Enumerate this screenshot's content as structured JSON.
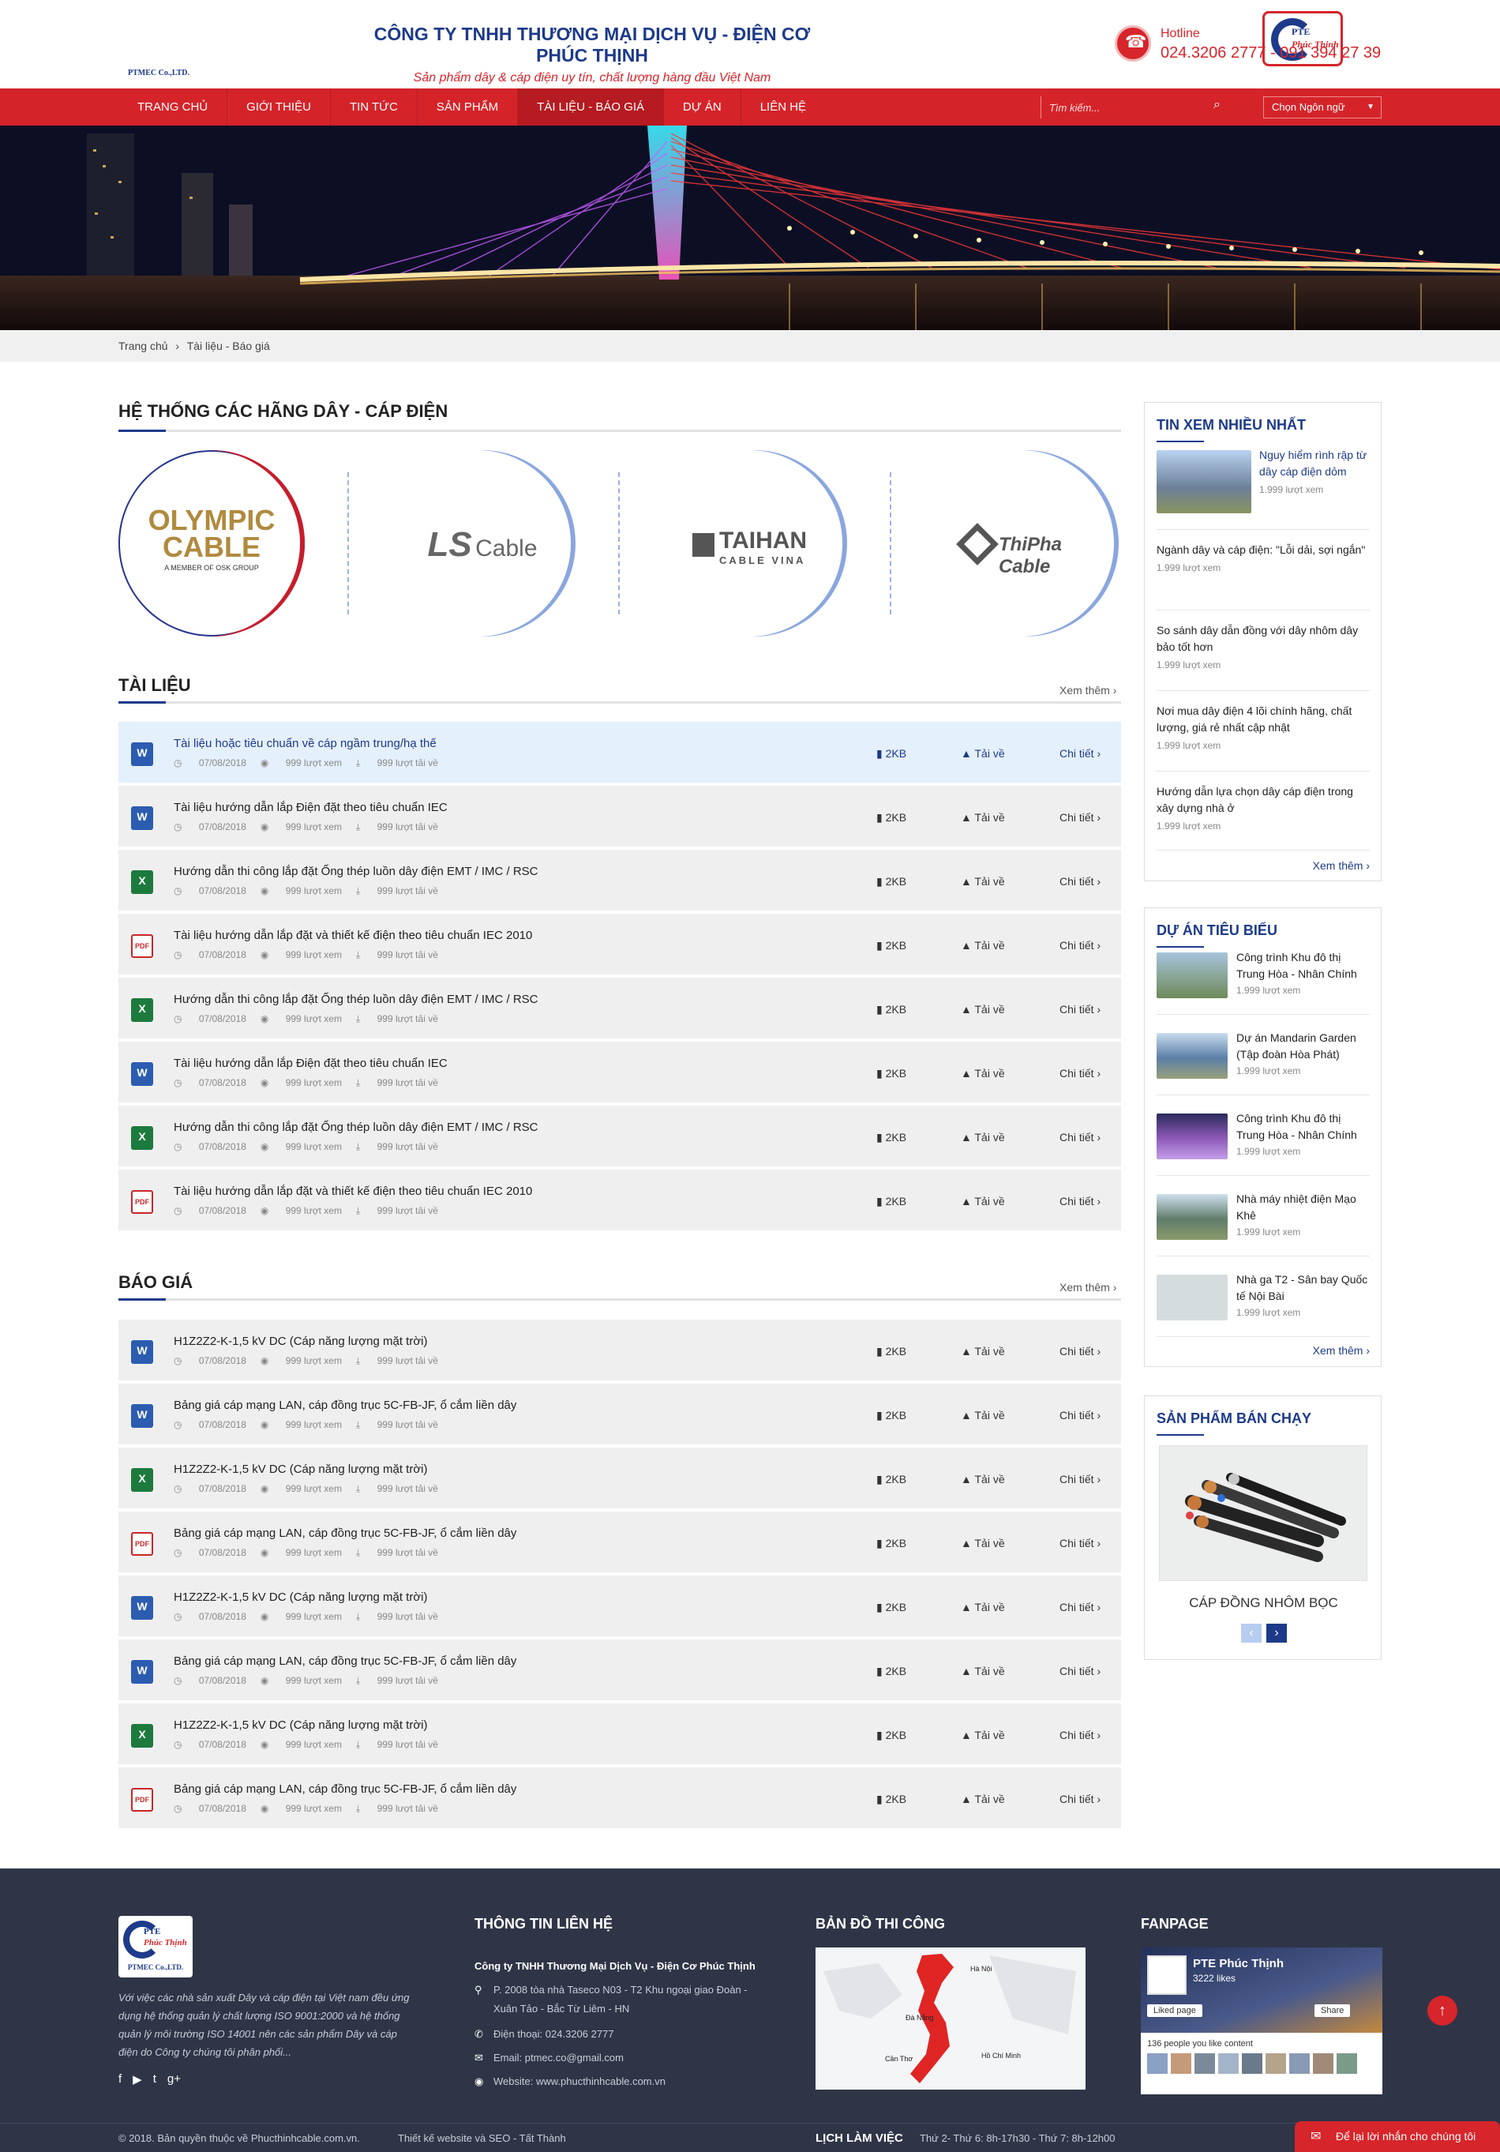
{
  "header": {
    "logo_pte": "PTE",
    "logo_name": "Phúc Thịnh",
    "logo_sub": "PTMEC Co.,LTD.",
    "company_name": "CÔNG TY TNHH THƯƠNG MẠI DỊCH VỤ - ĐIỆN CƠ PHÚC THỊNH",
    "slogan": "Sản phẩm dây & cáp điện uy tín, chất lượng hàng đầu Việt Nam",
    "hotline_label": "Hotline",
    "hotline_number": "024.3206 2777 - 091 394 27 39"
  },
  "nav": {
    "items": [
      "TRANG CHỦ",
      "GIỚI THIỆU",
      "TIN TỨC",
      "SẢN PHẨM",
      "TÀI LIỆU - BÁO GIÁ",
      "DỰ ÁN",
      "LIÊN HỆ"
    ],
    "active": "TÀI LIỆU - BÁO GIÁ",
    "search_placeholder": "Tìm kiếm...",
    "language": "Chọn Ngôn ngữ"
  },
  "breadcrumb": [
    "Trang chủ",
    "›",
    "Tài liệu - Báo giá"
  ],
  "brands": {
    "title": "HỆ THỐNG CÁC HÃNG DÂY - CÁP ĐIỆN",
    "items": [
      {
        "line1": "OLYMPIC",
        "line2": "CABLE",
        "sub": "A MEMBER OF OSK GROUP"
      },
      {
        "line1": "LS",
        "line2": "Cable"
      },
      {
        "line1": "TAIHAN",
        "line2": "CABLE VINA"
      },
      {
        "line1": "ThiPha Cable"
      }
    ]
  },
  "documents": {
    "title": "TÀI LIỆU",
    "more": "Xem thêm ›",
    "rows": [
      {
        "icon": "word",
        "title": "Tài liệu hoặc tiêu chuẩn về cáp ngầm trung/hạ thế",
        "date": "07/08/2018",
        "views": "999 lượt xem",
        "downloads": "999 lượt tải về",
        "size": "2KB",
        "dl": "Tải về",
        "detail": "Chi tiết ›"
      },
      {
        "icon": "word",
        "title": "Tài liệu hướng dẫn lắp Điện đặt theo tiêu chuẩn IEC",
        "date": "07/08/2018",
        "views": "999 lượt xem",
        "downloads": "999 lượt tải về",
        "size": "2KB",
        "dl": "Tải về",
        "detail": "Chi tiết ›"
      },
      {
        "icon": "excel",
        "title": "Hướng dẫn thi công lắp đặt Ống thép luồn dây điện EMT / IMC / RSC",
        "date": "07/08/2018",
        "views": "999 lượt xem",
        "downloads": "999 lượt tải về",
        "size": "2KB",
        "dl": "Tải về",
        "detail": "Chi tiết ›"
      },
      {
        "icon": "pdf",
        "title": "Tài liệu hướng dẫn lắp đặt và thiết kế điện theo tiêu chuẩn IEC 2010",
        "date": "07/08/2018",
        "views": "999 lượt xem",
        "downloads": "999 lượt tải về",
        "size": "2KB",
        "dl": "Tải về",
        "detail": "Chi tiết ›"
      },
      {
        "icon": "excel",
        "title": "Hướng dẫn thi công lắp đặt Ống thép luồn dây điện EMT / IMC / RSC",
        "date": "07/08/2018",
        "views": "999 lượt xem",
        "downloads": "999 lượt tải về",
        "size": "2KB",
        "dl": "Tải về",
        "detail": "Chi tiết ›"
      },
      {
        "icon": "word",
        "title": "Tài liệu hướng dẫn lắp Điện đặt theo tiêu chuẩn IEC",
        "date": "07/08/2018",
        "views": "999 lượt xem",
        "downloads": "999 lượt tải về",
        "size": "2KB",
        "dl": "Tải về",
        "detail": "Chi tiết ›"
      },
      {
        "icon": "excel",
        "title": "Hướng dẫn thi công lắp đặt Ống thép luồn dây điện EMT / IMC / RSC",
        "date": "07/08/2018",
        "views": "999 lượt xem",
        "downloads": "999 lượt tải về",
        "size": "2KB",
        "dl": "Tải về",
        "detail": "Chi tiết ›"
      },
      {
        "icon": "pdf",
        "title": "Tài liệu hướng dẫn lắp đặt và thiết kế điện theo tiêu chuẩn IEC 2010",
        "date": "07/08/2018",
        "views": "999 lượt xem",
        "downloads": "999 lượt tải về",
        "size": "2KB",
        "dl": "Tải về",
        "detail": "Chi tiết ›"
      }
    ]
  },
  "quotes": {
    "title": "BÁO GIÁ",
    "more": "Xem thêm ›",
    "rows": [
      {
        "icon": "word",
        "title": "H1Z2Z2-K-1,5 kV DC (Cáp năng lượng mặt trời)",
        "date": "07/08/2018",
        "views": "999 lượt xem",
        "downloads": "999 lượt tải về",
        "size": "2KB",
        "dl": "Tải về",
        "detail": "Chi tiết ›"
      },
      {
        "icon": "word",
        "title": "Bảng giá cáp mạng LAN, cáp đồng trục 5C-FB-JF, ổ cắm liền dây",
        "date": "07/08/2018",
        "views": "999 lượt xem",
        "downloads": "999 lượt tải về",
        "size": "2KB",
        "dl": "Tải về",
        "detail": "Chi tiết ›"
      },
      {
        "icon": "excel",
        "title": "H1Z2Z2-K-1,5 kV DC (Cáp năng lượng mặt trời)",
        "date": "07/08/2018",
        "views": "999 lượt xem",
        "downloads": "999 lượt tải về",
        "size": "2KB",
        "dl": "Tải về",
        "detail": "Chi tiết ›"
      },
      {
        "icon": "pdf",
        "title": "Bảng giá cáp mạng LAN, cáp đồng trục 5C-FB-JF, ổ cắm liền dây",
        "date": "07/08/2018",
        "views": "999 lượt xem",
        "downloads": "999 lượt tải về",
        "size": "2KB",
        "dl": "Tải về",
        "detail": "Chi tiết ›"
      },
      {
        "icon": "word",
        "title": "H1Z2Z2-K-1,5 kV DC (Cáp năng lượng mặt trời)",
        "date": "07/08/2018",
        "views": "999 lượt xem",
        "downloads": "999 lượt tải về",
        "size": "2KB",
        "dl": "Tải về",
        "detail": "Chi tiết ›"
      },
      {
        "icon": "word",
        "title": "Bảng giá cáp mạng LAN, cáp đồng trục 5C-FB-JF, ổ cắm liền dây",
        "date": "07/08/2018",
        "views": "999 lượt xem",
        "downloads": "999 lượt tải về",
        "size": "2KB",
        "dl": "Tải về",
        "detail": "Chi tiết ›"
      },
      {
        "icon": "excel",
        "title": "H1Z2Z2-K-1,5 kV DC (Cáp năng lượng mặt trời)",
        "date": "07/08/2018",
        "views": "999 lượt xem",
        "downloads": "999 lượt tải về",
        "size": "2KB",
        "dl": "Tải về",
        "detail": "Chi tiết ›"
      },
      {
        "icon": "pdf",
        "title": "Bảng giá cáp mạng LAN, cáp đồng trục 5C-FB-JF, ổ cắm liền dây",
        "date": "07/08/2018",
        "views": "999 lượt xem",
        "downloads": "999 lượt tải về",
        "size": "2KB",
        "dl": "Tải về",
        "detail": "Chi tiết ›"
      }
    ]
  },
  "sidebar": {
    "popular": {
      "title": "TIN XEM NHIỀU NHẤT",
      "featured": {
        "title": "Nguy hiểm rình rập từ dây cáp điện dỏm",
        "views": "1.999 lượt xem"
      },
      "items": [
        {
          "title": "Ngành dây và cáp điện: \"Lỗi dải, sợi ngắn\"",
          "views": "1.999 lượt xem"
        },
        {
          "title": "So sánh dây dẫn đồng với dây nhôm dây bảo tốt hơn",
          "views": "1.999 lượt xem"
        },
        {
          "title": "Nơi mua dây điện 4 lõi chính hãng, chất lượng, giá rẻ nhất cập nhật",
          "views": "1.999 lượt xem"
        },
        {
          "title": "Hướng dẫn lựa chọn dây cáp điện trong xây dựng nhà ở",
          "views": "1.999 lượt xem"
        }
      ],
      "more": "Xem thêm ›"
    },
    "projects": {
      "title": "DỰ ÁN TIÊU BIỂU",
      "items": [
        {
          "title": "Công trình Khu đô thị Trung Hòa - Nhân Chính",
          "views": "1.999 lượt xem"
        },
        {
          "title": "Dự án Mandarin Garden (Tập đoàn Hòa Phát)",
          "views": "1.999 lượt xem"
        },
        {
          "title": "Công trình Khu đô thị Trung Hòa - Nhân Chính",
          "views": "1.999 lượt xem"
        },
        {
          "title": "Nhà máy nhiệt điện Mạo Khê",
          "views": "1.999 lượt xem"
        },
        {
          "title": "Nhà ga T2 - Sân bay Quốc tế Nội Bài",
          "views": "1.999 lượt xem"
        }
      ],
      "more": "Xem thêm ›"
    },
    "bestseller": {
      "title": "SẢN PHẨM BÁN CHẠY",
      "product": "CÁP ĐỒNG NHÔM BỌC",
      "prev": "‹",
      "next": "›"
    }
  },
  "footer": {
    "about": "Với việc các nhà sản xuất Dây và cáp điện tại Việt nam đều ứng dụng hệ thống quản lý chất lượng ISO 9001:2000 và hệ thống quản lý môi trường ISO 14001 nên các sản phẩm Dây và cáp điện do Công ty chúng tôi phân phối...",
    "social": [
      "f",
      "▶",
      "t",
      "g+"
    ],
    "contact_title": "THÔNG TIN LIÊN HỆ",
    "contact_company": "Công ty TNHH Thương Mại Dịch Vụ - Điện Cơ Phúc Thịnh",
    "address": "P. 2008 tòa nhà Taseco N03 - T2 Khu ngoại giao Đoàn - Xuân Tảo - Bắc Từ Liêm - HN",
    "phone": "Điện thoại: 024.3206 2777",
    "email": "Email: ptmec.co@gmail.com",
    "website": "Website: www.phucthinhcable.com.vn",
    "map_title": "BẢN ĐỒ THI CÔNG",
    "map_labels": [
      "Hà Nội",
      "Đà Nẵng",
      "Hồ Chí Minh",
      "Cần Thơ"
    ],
    "fanpage_title": "FANPAGE",
    "fb_name": "PTE Phúc Thịnh",
    "fb_likes": "3222 likes",
    "fb_like_btn": "Liked page",
    "fb_share": "Share",
    "fb_friends": "136 people you like content",
    "copyright": "© 2018. Bản quyền thuộc về Phucthinhcable.com.vn.",
    "designer": "Thiết kế website và SEO - Tất Thành",
    "hours_title": "LỊCH LÀM VIỆC",
    "hours": "Thứ 2- Thứ 6: 8h-17h30 - Thứ 7: 8h-12h00",
    "chat": "Để lại lời nhắn cho chúng tôi"
  }
}
